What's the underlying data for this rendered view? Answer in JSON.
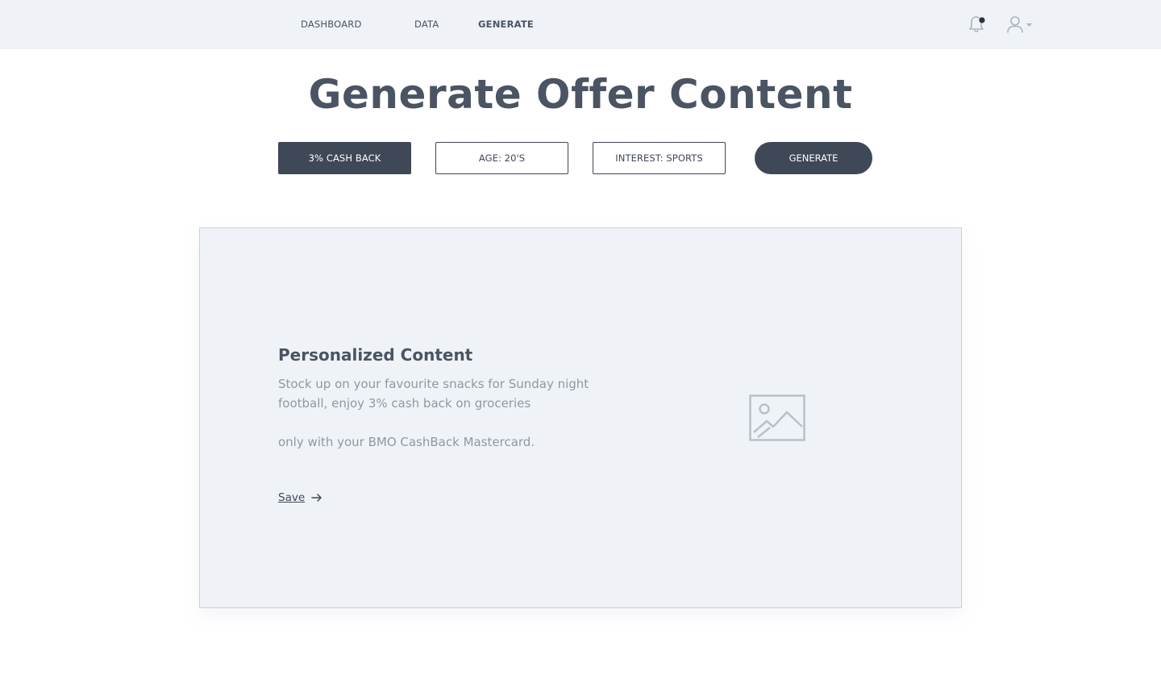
{
  "nav": {
    "dashboard": "DASHBOARD",
    "data": "DATA",
    "generate": "GENERATE",
    "active": "generate"
  },
  "icons": {
    "notifications": "bell-icon",
    "user": "user-icon",
    "user_menu": "chevron-down-icon",
    "save_arrow": "arrow-right-icon",
    "image": "image-placeholder-icon"
  },
  "page": {
    "title": "Generate Offer Content"
  },
  "filters": {
    "offer": "3% CASH BACK",
    "age": "AGE: 20'S",
    "interest": "INTEREST: SPORTS"
  },
  "actions": {
    "generate": "GENERATE"
  },
  "content_card": {
    "title": "Personalized Content",
    "body": "Stock up on your favourite snacks for Sunday night football, enjoy 3% cash back on groceries\n\nonly with your BMO CashBack Mastercard.",
    "save_label": "Save"
  },
  "colors": {
    "primary_dark": "#3f4857",
    "text": "#4a5462",
    "muted_text": "#8e98a4",
    "panel_bg": "#eff3f7",
    "notification_dot": "#2d3440"
  }
}
